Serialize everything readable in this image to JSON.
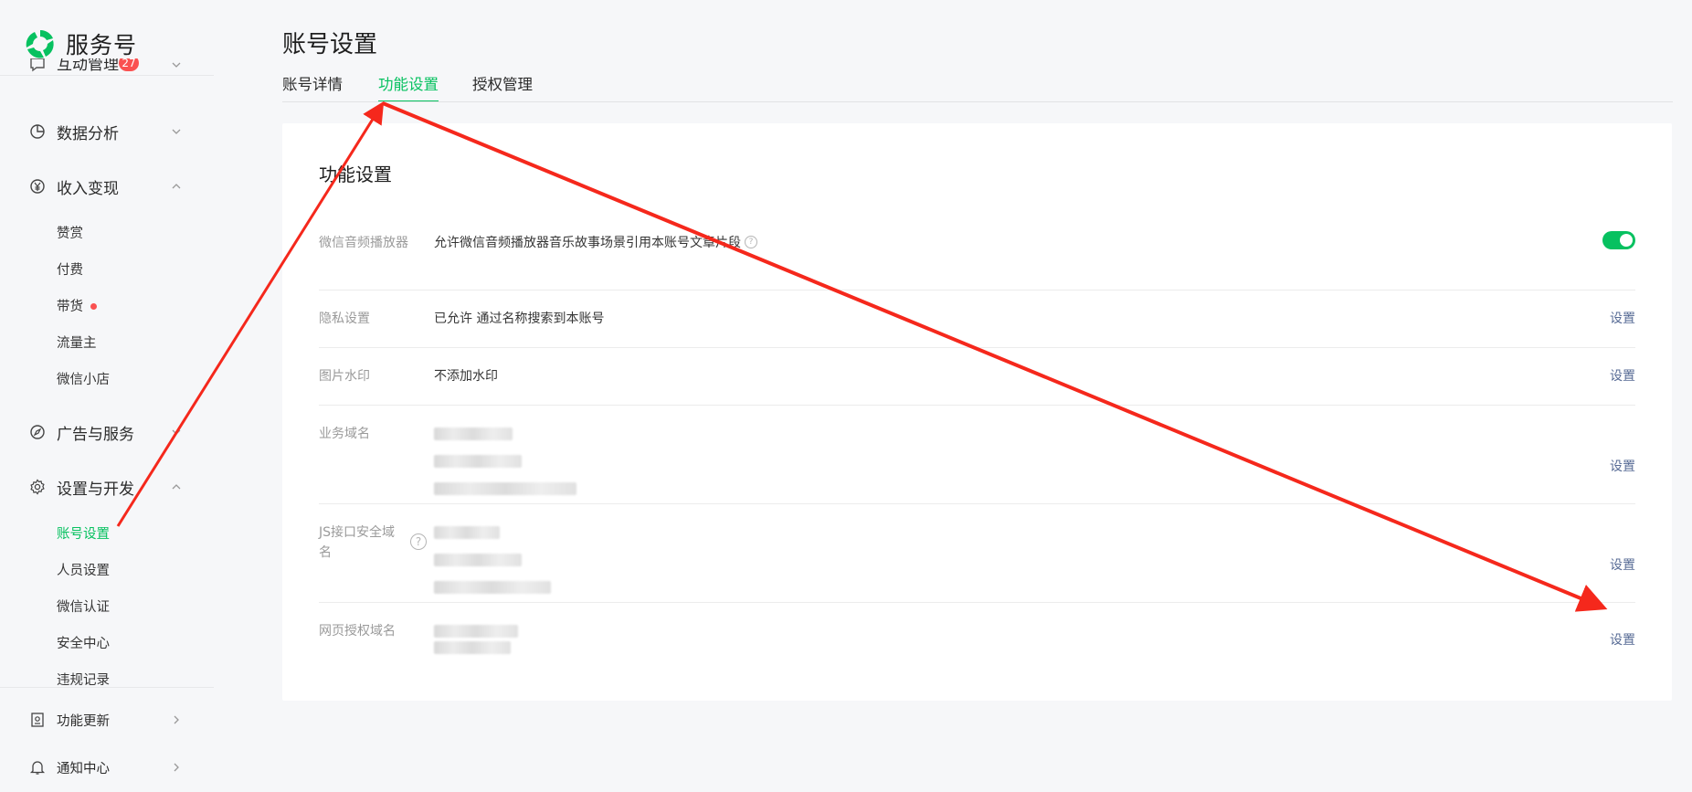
{
  "brand": {
    "name": "服务号"
  },
  "sidebar": {
    "top_cut": {
      "label": "互动管理",
      "badge": "27"
    },
    "groups": [
      {
        "label": "数据分析",
        "icon": "pie-chart-icon",
        "expanded": false
      },
      {
        "label": "收入变现",
        "icon": "yen-circle-icon",
        "expanded": true,
        "items": [
          {
            "label": "赞赏"
          },
          {
            "label": "付费"
          },
          {
            "label": "带货",
            "dot": true
          },
          {
            "label": "流量主"
          },
          {
            "label": "微信小店"
          }
        ]
      },
      {
        "label": "广告与服务",
        "icon": "compass-icon",
        "expanded": false
      },
      {
        "label": "设置与开发",
        "icon": "gear-icon",
        "expanded": true,
        "items": [
          {
            "label": "账号设置",
            "active": true
          },
          {
            "label": "人员设置"
          },
          {
            "label": "微信认证"
          },
          {
            "label": "安全中心"
          },
          {
            "label": "违规记录"
          }
        ]
      }
    ],
    "bottom": [
      {
        "label": "功能更新",
        "icon": "update-icon"
      },
      {
        "label": "通知中心",
        "icon": "bell-icon"
      }
    ]
  },
  "main": {
    "title": "账号设置",
    "tabs": [
      {
        "label": "账号详情"
      },
      {
        "label": "功能设置",
        "active": true
      },
      {
        "label": "授权管理"
      }
    ],
    "card": {
      "title": "功能设置",
      "rows": [
        {
          "label": "微信音频播放器",
          "value": "允许微信音频播放器音乐故事场景引用本账号文章片段",
          "toggle_on": true
        },
        {
          "label": "隐私设置",
          "value": "已允许 通过名称搜索到本账号",
          "link": "设置"
        },
        {
          "label": "图片水印",
          "value": "不添加水印",
          "link": "设置"
        },
        {
          "label": "业务域名",
          "value": "",
          "link": "设置"
        },
        {
          "label": "JS接口安全域名",
          "value": "",
          "link": "设置"
        },
        {
          "label": "网页授权域名",
          "value": "",
          "link": "设置"
        }
      ]
    }
  },
  "colors": {
    "accent": "#07c160",
    "link": "#576b95",
    "badge": "#fa5151",
    "annotation_arrow": "#f5281c"
  }
}
